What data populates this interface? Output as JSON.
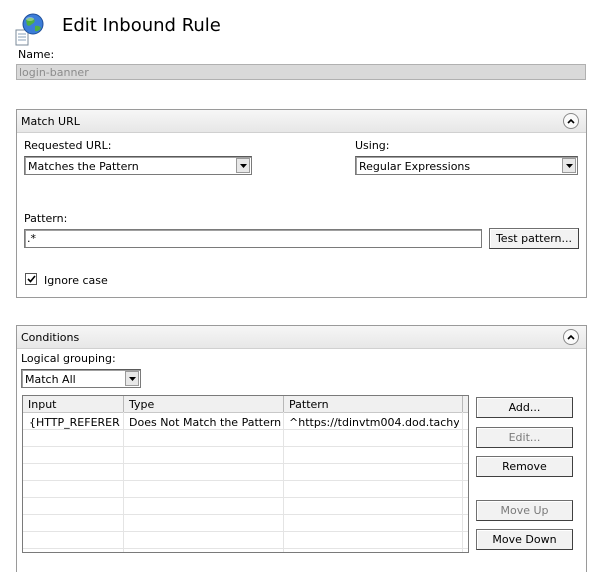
{
  "header": {
    "icon": "globe-document-icon",
    "title": "Edit Inbound Rule"
  },
  "name": {
    "label": "Name:",
    "value": "login-banner"
  },
  "match_url": {
    "title": "Match URL",
    "requested_url_label": "Requested URL:",
    "requested_url_value": "Matches the Pattern",
    "using_label": "Using:",
    "using_value": "Regular Expressions",
    "pattern_label": "Pattern:",
    "pattern_value": ".*",
    "test_pattern_button": "Test pattern...",
    "ignore_case_label": "Ignore case",
    "ignore_case_checked": true
  },
  "conditions": {
    "title": "Conditions",
    "logical_grouping_label": "Logical grouping:",
    "logical_grouping_value": "Match All",
    "columns": [
      "Input",
      "Type",
      "Pattern"
    ],
    "rows": [
      {
        "input": "{HTTP_REFERER}",
        "type": "Does Not Match the Pattern",
        "pattern": "^https://tdinvtm004.dod.tachy..."
      }
    ],
    "buttons": {
      "add": "Add...",
      "edit": "Edit...",
      "remove": "Remove",
      "move_up": "Move Up",
      "move_down": "Move Down"
    }
  }
}
